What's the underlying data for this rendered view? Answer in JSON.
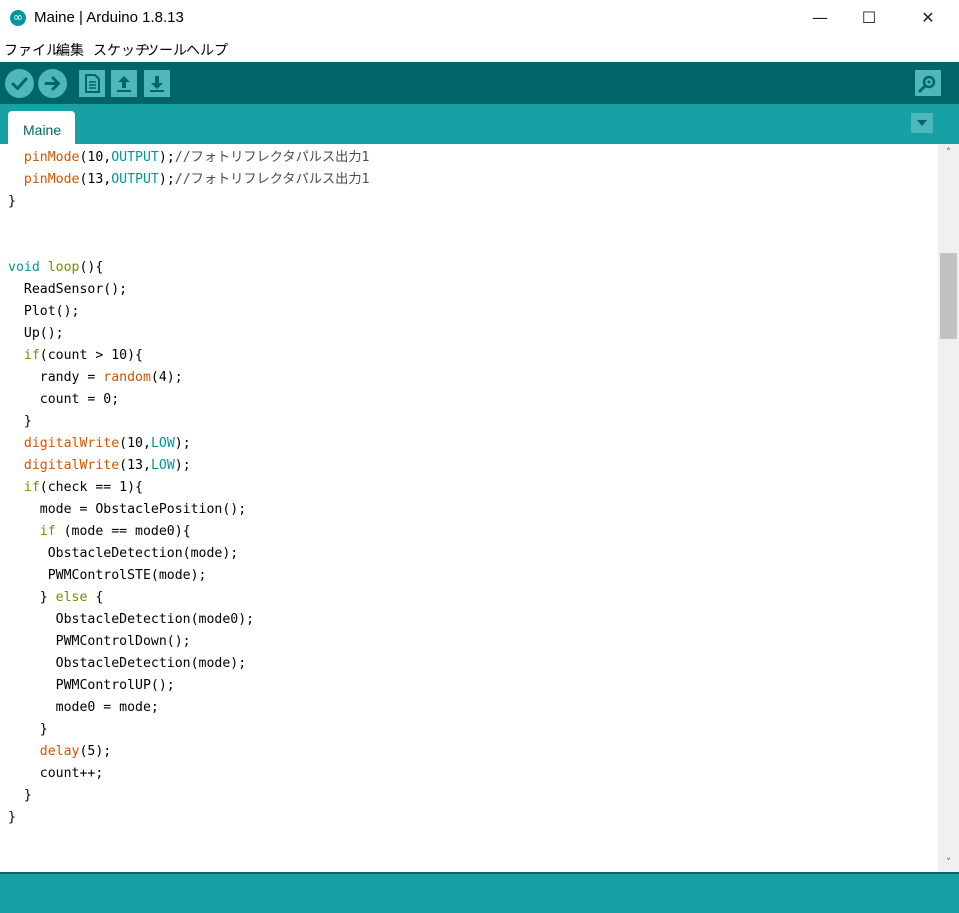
{
  "window": {
    "title": "Maine | Arduino 1.8.13",
    "app_icon": "arduino-infinity-icon",
    "controls": {
      "minimize": "—",
      "maximize": "☐",
      "close": "✕"
    }
  },
  "menu": {
    "items": [
      "ファイル",
      "編集",
      "スケッチ",
      "ツール",
      "ヘルプ"
    ]
  },
  "toolbar": {
    "buttons": [
      "verify-icon",
      "upload-icon",
      "new-icon",
      "open-icon",
      "save-icon"
    ],
    "right_button": "serial-monitor-icon"
  },
  "tabs": {
    "items": [
      {
        "label": "Maine"
      }
    ],
    "menu_icon": "tab-menu-icon"
  },
  "colors": {
    "toolbar": "#006468",
    "tabbar": "#17a1a5",
    "function": "#d35400",
    "constant": "#00979c",
    "keyword": "#728e00"
  },
  "editor": {
    "lines": [
      [
        {
          "t": "  "
        },
        {
          "t": "pinMode",
          "c": "fn"
        },
        {
          "t": "(10,"
        },
        {
          "t": "OUTPUT",
          "c": "const"
        },
        {
          "t": ");"
        },
        {
          "t": "//フォトリフレクタパルス出力1",
          "c": "com"
        }
      ],
      [
        {
          "t": "  "
        },
        {
          "t": "pinMode",
          "c": "fn"
        },
        {
          "t": "(13,"
        },
        {
          "t": "OUTPUT",
          "c": "const"
        },
        {
          "t": ");"
        },
        {
          "t": "//フォトリフレクタパルス出力1",
          "c": "com"
        }
      ],
      [
        {
          "t": "}"
        }
      ],
      [
        {
          "t": ""
        }
      ],
      [
        {
          "t": ""
        }
      ],
      [
        {
          "t": "void",
          "c": "type"
        },
        {
          "t": " "
        },
        {
          "t": "loop",
          "c": "kw"
        },
        {
          "t": "(){"
        }
      ],
      [
        {
          "t": "  ReadSensor();"
        }
      ],
      [
        {
          "t": "  Plot();"
        }
      ],
      [
        {
          "t": "  Up();"
        }
      ],
      [
        {
          "t": "  "
        },
        {
          "t": "if",
          "c": "kw"
        },
        {
          "t": "(count > 10){"
        }
      ],
      [
        {
          "t": "    randy = "
        },
        {
          "t": "random",
          "c": "fn"
        },
        {
          "t": "(4);"
        }
      ],
      [
        {
          "t": "    count = 0;"
        }
      ],
      [
        {
          "t": "  }"
        }
      ],
      [
        {
          "t": "  "
        },
        {
          "t": "digitalWrite",
          "c": "fn"
        },
        {
          "t": "(10,"
        },
        {
          "t": "LOW",
          "c": "const"
        },
        {
          "t": ");"
        }
      ],
      [
        {
          "t": "  "
        },
        {
          "t": "digitalWrite",
          "c": "fn"
        },
        {
          "t": "(13,"
        },
        {
          "t": "LOW",
          "c": "const"
        },
        {
          "t": ");"
        }
      ],
      [
        {
          "t": "  "
        },
        {
          "t": "if",
          "c": "kw"
        },
        {
          "t": "(check == 1){"
        }
      ],
      [
        {
          "t": "    mode = ObstaclePosition();"
        }
      ],
      [
        {
          "t": "    "
        },
        {
          "t": "if",
          "c": "kw"
        },
        {
          "t": " (mode == mode0){"
        }
      ],
      [
        {
          "t": "     ObstacleDetection(mode);"
        }
      ],
      [
        {
          "t": "     PWMControlSTE(mode);"
        }
      ],
      [
        {
          "t": "    } "
        },
        {
          "t": "else",
          "c": "kw"
        },
        {
          "t": " {"
        }
      ],
      [
        {
          "t": "      ObstacleDetection(mode0);"
        }
      ],
      [
        {
          "t": "      PWMControlDown();"
        }
      ],
      [
        {
          "t": "      ObstacleDetection(mode);"
        }
      ],
      [
        {
          "t": "      PWMControlUP();"
        }
      ],
      [
        {
          "t": "      mode0 = mode;"
        }
      ],
      [
        {
          "t": "    }"
        }
      ],
      [
        {
          "t": "    "
        },
        {
          "t": "delay",
          "c": "fn"
        },
        {
          "t": "(5);"
        }
      ],
      [
        {
          "t": "    count++;"
        }
      ],
      [
        {
          "t": "  }"
        }
      ],
      [
        {
          "t": "}"
        }
      ]
    ]
  },
  "scrollbar": {
    "up": "˄",
    "down": "˅",
    "position": 0.15
  }
}
